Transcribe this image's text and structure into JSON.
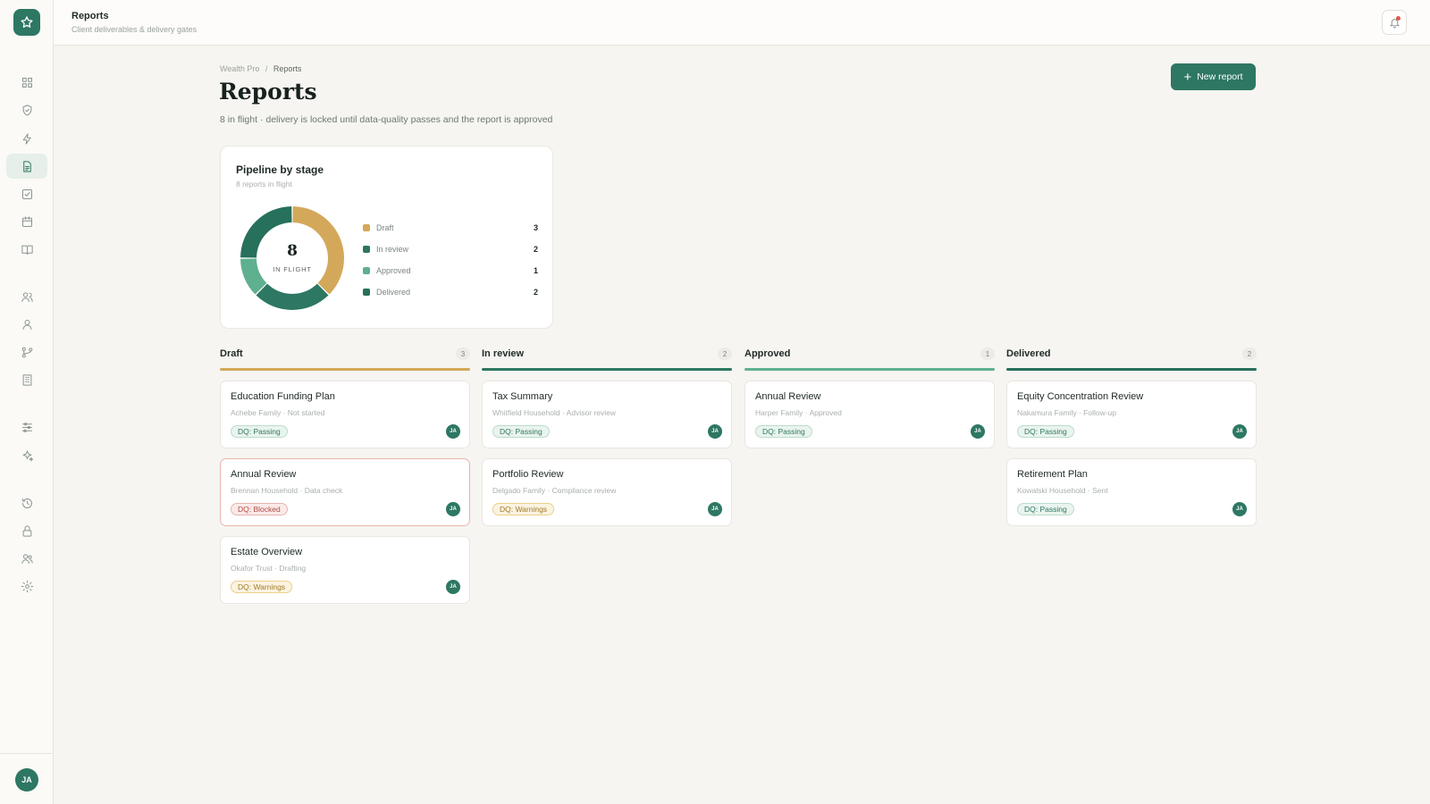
{
  "topbar": {
    "title": "Reports",
    "subtitle": "Client deliverables & delivery gates"
  },
  "user": {
    "initials": "JA"
  },
  "breadcrumb": {
    "root": "Wealth Pro",
    "separator": "/",
    "current": "Reports"
  },
  "page": {
    "title": "Reports",
    "subtitle": "8 in flight · delivery is locked until data-quality passes and the report is approved",
    "new_button": "New report"
  },
  "sidebar": {
    "items": [
      {
        "icon": "grid-icon"
      },
      {
        "icon": "shield-icon"
      },
      {
        "icon": "bolt-icon"
      },
      {
        "icon": "document-icon",
        "active": true
      },
      {
        "icon": "checkbox-icon"
      },
      {
        "icon": "calendar-icon"
      },
      {
        "icon": "book-icon"
      },
      {
        "icon": "users-icon"
      },
      {
        "icon": "user-icon"
      },
      {
        "icon": "git-branch-icon"
      },
      {
        "icon": "building-icon"
      },
      {
        "icon": "sliders-icon"
      },
      {
        "icon": "sparkles-icon"
      },
      {
        "icon": "history-icon"
      },
      {
        "icon": "lock-icon"
      },
      {
        "icon": "team-icon"
      },
      {
        "icon": "gear-icon"
      }
    ]
  },
  "pipeline": {
    "title": "Pipeline by stage",
    "subtitle": "8 reports in flight",
    "center_value": "8",
    "center_label": "IN FLIGHT",
    "chart_data": {
      "type": "pie",
      "categories": [
        "Draft",
        "In review",
        "Approved",
        "Delivered"
      ],
      "values": [
        3,
        2,
        1,
        2
      ],
      "colors": [
        "#d4a85a",
        "#2d7763",
        "#5fb08e",
        "#27705b"
      ]
    }
  },
  "columns": [
    {
      "name": "Draft",
      "count": "3",
      "color": "#d4a85a",
      "cards": [
        {
          "title": "Education Funding Plan",
          "meta": "Achebe Family · Not started",
          "badge": "DQ: Passing",
          "status": "pass",
          "avatar": "JA"
        },
        {
          "title": "Annual Review",
          "meta": "Brennan Household · Data check",
          "badge": "DQ: Blocked",
          "status": "block",
          "avatar": "JA"
        },
        {
          "title": "Estate Overview",
          "meta": "Okafor Trust · Drafting",
          "badge": "DQ: Warnings",
          "status": "warn",
          "avatar": "JA"
        }
      ]
    },
    {
      "name": "In review",
      "count": "2",
      "color": "#2d7763",
      "cards": [
        {
          "title": "Tax Summary",
          "meta": "Whitfield Household · Advisor review",
          "badge": "DQ: Passing",
          "status": "pass",
          "avatar": "JA"
        },
        {
          "title": "Portfolio Review",
          "meta": "Delgado Family · Compliance review",
          "badge": "DQ: Warnings",
          "status": "warn",
          "avatar": "JA"
        }
      ]
    },
    {
      "name": "Approved",
      "count": "1",
      "color": "#5fb08e",
      "cards": [
        {
          "title": "Annual Review",
          "meta": "Harper Family · Approved",
          "badge": "DQ: Passing",
          "status": "pass",
          "avatar": "JA"
        }
      ]
    },
    {
      "name": "Delivered",
      "count": "2",
      "color": "#27705b",
      "cards": [
        {
          "title": "Equity Concentration Review",
          "meta": "Nakamura Family · Follow-up",
          "badge": "DQ: Passing",
          "status": "pass",
          "avatar": "JA"
        },
        {
          "title": "Retirement Plan",
          "meta": "Kowalski Household · Sent",
          "badge": "DQ: Passing",
          "status": "pass",
          "avatar": "JA"
        }
      ]
    }
  ]
}
